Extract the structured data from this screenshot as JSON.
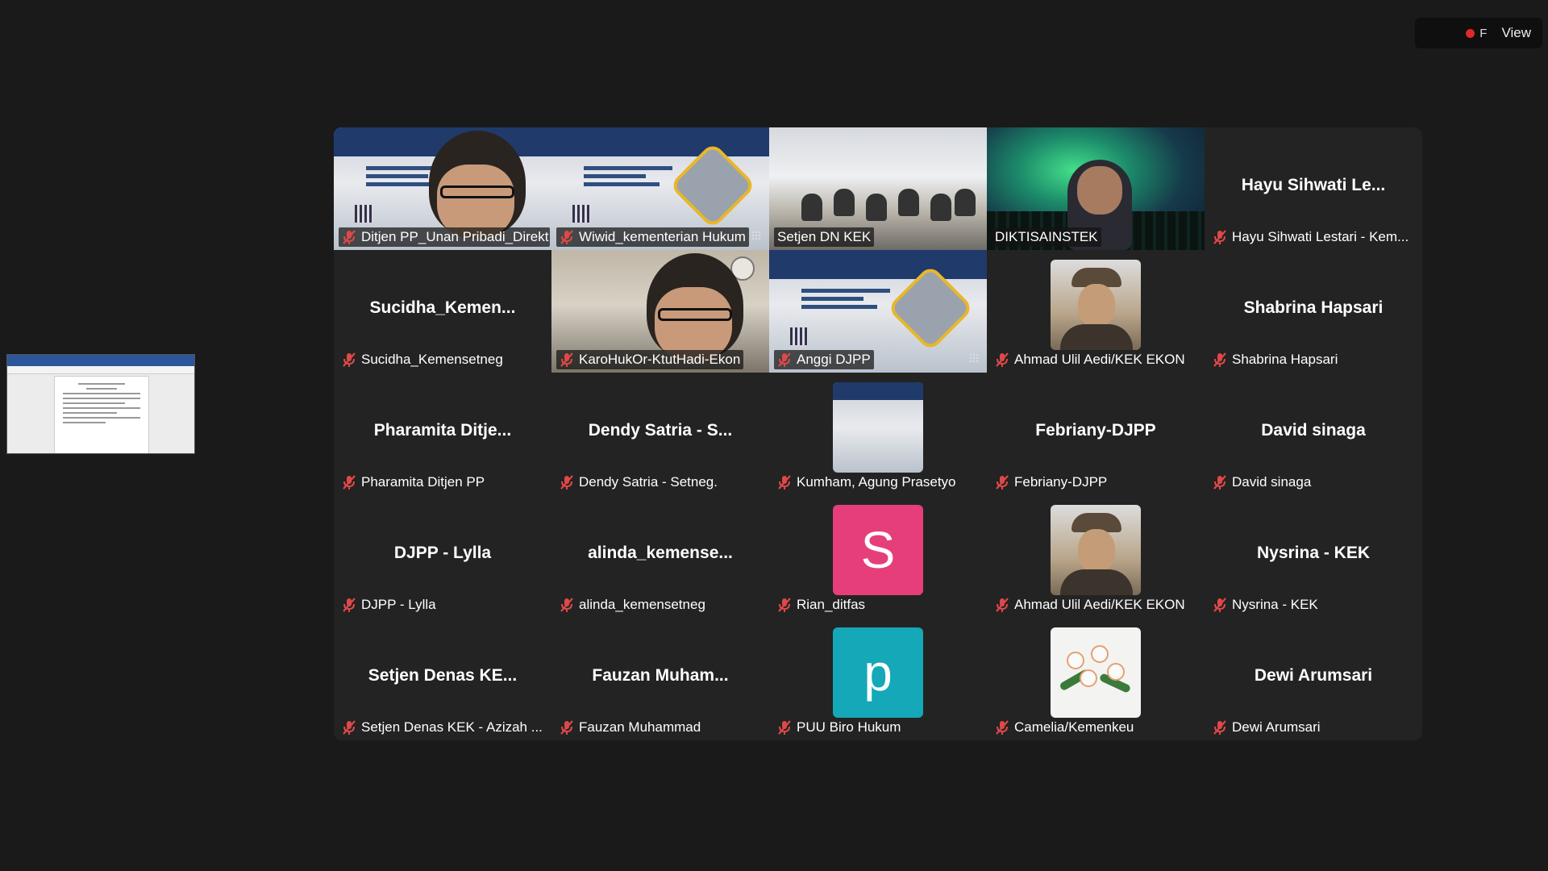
{
  "window": {
    "recording_letter": "F",
    "view_label": "View"
  },
  "accent": {
    "active_speaker_border": "#23d96b",
    "muted_icon": "#e04848",
    "recording_dot": "#e02828"
  },
  "participants": [
    {
      "display": "Ditjen PP_Unan Pribadi_Direkt...",
      "big_name": "",
      "mode": "video-poster-face"
    },
    {
      "display": "Wiwid_kementerian Hukum",
      "big_name": "",
      "mode": "video-poster"
    },
    {
      "display": "Setjen DN KEK",
      "big_name": "",
      "mode": "video-room"
    },
    {
      "display": "DIKTISAINSTEK",
      "big_name": "",
      "mode": "video-aurora",
      "active": true
    },
    {
      "display": "Hayu Sihwati Lestari - Kem...",
      "big_name": "Hayu Sihwati Le...",
      "mode": "name"
    },
    {
      "display": "Sucidha_Kemensetneg",
      "big_name": "Sucidha_Kemen...",
      "mode": "name"
    },
    {
      "display": "KaroHukOr-KtutHadi-Ekon",
      "big_name": "",
      "mode": "video-office"
    },
    {
      "display": "Anggi DJPP",
      "big_name": "",
      "mode": "video-poster"
    },
    {
      "display": "Ahmad Ulil Aedi/KEK EKON",
      "big_name": "",
      "mode": "avatar-photo"
    },
    {
      "display": "Shabrina Hapsari",
      "big_name": "Shabrina Hapsari",
      "mode": "name"
    },
    {
      "display": "Pharamita Ditjen PP",
      "big_name": "Pharamita Ditje...",
      "mode": "name"
    },
    {
      "display": "Dendy Satria - Setneg.",
      "big_name": "Dendy Satria - S...",
      "mode": "name"
    },
    {
      "display": "Kumham, Agung Prasetyo",
      "big_name": "",
      "mode": "avatar-poster"
    },
    {
      "display": "Febriany-DJPP",
      "big_name": "Febriany-DJPP",
      "mode": "name"
    },
    {
      "display": "David sinaga",
      "big_name": "David sinaga",
      "mode": "name"
    },
    {
      "display": "DJPP - Lylla",
      "big_name": "DJPP - Lylla",
      "mode": "name"
    },
    {
      "display": "alinda_kemensetneg",
      "big_name": "alinda_kemense...",
      "mode": "name"
    },
    {
      "display": "Rian_ditfas",
      "big_name": "",
      "mode": "avatar-letter",
      "letter": "S",
      "color": "#e53e7a"
    },
    {
      "display": "Ahmad Ulil Aedi/KEK EKON",
      "big_name": "",
      "mode": "avatar-photo"
    },
    {
      "display": "Nysrina - KEK",
      "big_name": "Nysrina - KEK",
      "mode": "name"
    },
    {
      "display": "Setjen Denas KEK - Azizah ...",
      "big_name": "Setjen Denas KE...",
      "mode": "name"
    },
    {
      "display": "Fauzan Muhammad",
      "big_name": "Fauzan Muham...",
      "mode": "name"
    },
    {
      "display": "PUU Biro Hukum",
      "big_name": "",
      "mode": "avatar-letter",
      "letter": "p",
      "color": "#14a8b8"
    },
    {
      "display": "Camelia/Kemenkeu",
      "big_name": "",
      "mode": "avatar-flowers"
    },
    {
      "display": "Dewi Arumsari",
      "big_name": "Dewi Arumsari",
      "mode": "name"
    }
  ]
}
